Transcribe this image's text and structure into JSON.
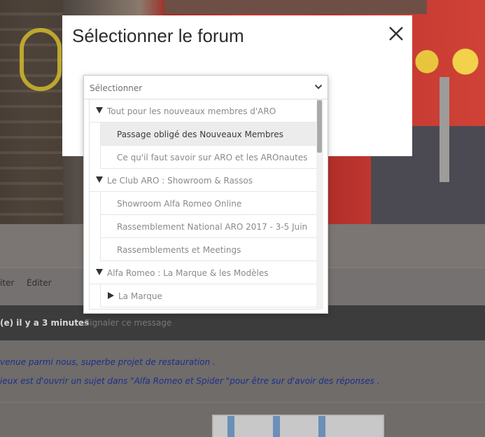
{
  "modal": {
    "title": "Sélectionner le forum",
    "close_icon": "close-icon"
  },
  "select": {
    "selected_value": "Sélectionner",
    "items": [
      {
        "type": "category",
        "label": "Tout pour les nouveaux membres d'ARO",
        "expanded": true
      },
      {
        "type": "forum",
        "label": "Passage obligé des Nouveaux Membres",
        "highlighted": true
      },
      {
        "type": "forum",
        "label": "Ce qu'il faut savoir sur ARO et les AROnautes"
      },
      {
        "type": "category",
        "label": "Le Club ARO : Showroom & Rassos",
        "expanded": true
      },
      {
        "type": "forum",
        "label": "Showroom Alfa Romeo Online"
      },
      {
        "type": "forum",
        "label": "Rassemblement National ARO 2017 - 3-5 Juin"
      },
      {
        "type": "forum",
        "label": "Rassemblements et Meetings"
      },
      {
        "type": "category",
        "label": "Alfa Romeo : La Marque & les Modèles",
        "expanded": true
      },
      {
        "type": "forum-collapsed",
        "label": "La Marque"
      }
    ]
  },
  "background": {
    "toolbar": {
      "quote_label": "iter",
      "edit_label": "Éditer"
    },
    "post_meta": {
      "time": "(e) il y a 3 minutes",
      "report": "· Signaler ce message"
    },
    "post_lines": [
      "venue parmi nous, superbe projet de restauration .",
      "ieux est d'ouvrir un sujet dans \"Alfa Romeo et Spider \"pour être sur d'avoir des réponses ."
    ]
  },
  "colors": {
    "overlay": "#6f6a66",
    "modal_bg": "#ffffff",
    "highlight_row": "#ececec",
    "post_text": "#1d2f8c"
  }
}
